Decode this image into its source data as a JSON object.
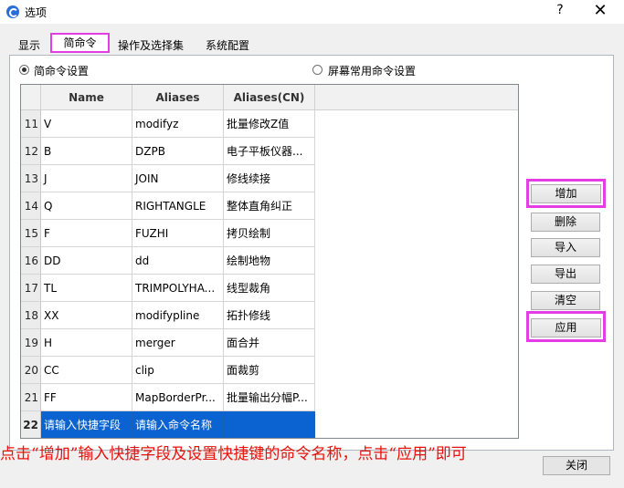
{
  "window": {
    "title": "选项",
    "help": "?",
    "close": "✕"
  },
  "tabs": [
    "显示",
    "简命令",
    "操作及选择集",
    "系统配置"
  ],
  "radios": {
    "left": "简命令设置",
    "right": "屏幕常用命令设置"
  },
  "grid": {
    "columns": [
      "Name",
      "Aliases",
      "Aliases(CN)"
    ],
    "rows": [
      {
        "num": "11",
        "name": "V",
        "alias": "modifyz",
        "cn": "批量修改Z值"
      },
      {
        "num": "12",
        "name": "B",
        "alias": "DZPB",
        "cn": "电子平板仪器..."
      },
      {
        "num": "13",
        "name": "J",
        "alias": "JOIN",
        "cn": "修线续接"
      },
      {
        "num": "14",
        "name": "Q",
        "alias": "RIGHTANGLE",
        "cn": "整体直角纠正"
      },
      {
        "num": "15",
        "name": "F",
        "alias": "FUZHI",
        "cn": "拷贝绘制"
      },
      {
        "num": "16",
        "name": "DD",
        "alias": "dd",
        "cn": "绘制地物"
      },
      {
        "num": "17",
        "name": "TL",
        "alias": "TRIMPOLYHA...",
        "cn": "线型裁角"
      },
      {
        "num": "18",
        "name": "XX",
        "alias": "modifypline",
        "cn": "拓扑修线"
      },
      {
        "num": "19",
        "name": "H",
        "alias": "merger",
        "cn": "面合并"
      },
      {
        "num": "20",
        "name": "CC",
        "alias": "clip",
        "cn": "面裁剪"
      },
      {
        "num": "21",
        "name": "FF",
        "alias": "MapBorderPr...",
        "cn": "批量输出分幅P..."
      },
      {
        "num": "22",
        "name": "请输入快捷字段",
        "alias": "请输入命令名称",
        "cn": ""
      }
    ]
  },
  "buttons": {
    "add": "增加",
    "delete": "删除",
    "import": "导入",
    "export": "导出",
    "clear": "清空",
    "apply": "应用",
    "close": "关闭"
  },
  "instruction": "点击“增加”输入快捷字段及设置快捷键的命令名称，点击“应用”即可",
  "colors": {
    "highlight": "#e23ee4",
    "selection": "#0a63d0",
    "instruction": "#e8120c"
  }
}
